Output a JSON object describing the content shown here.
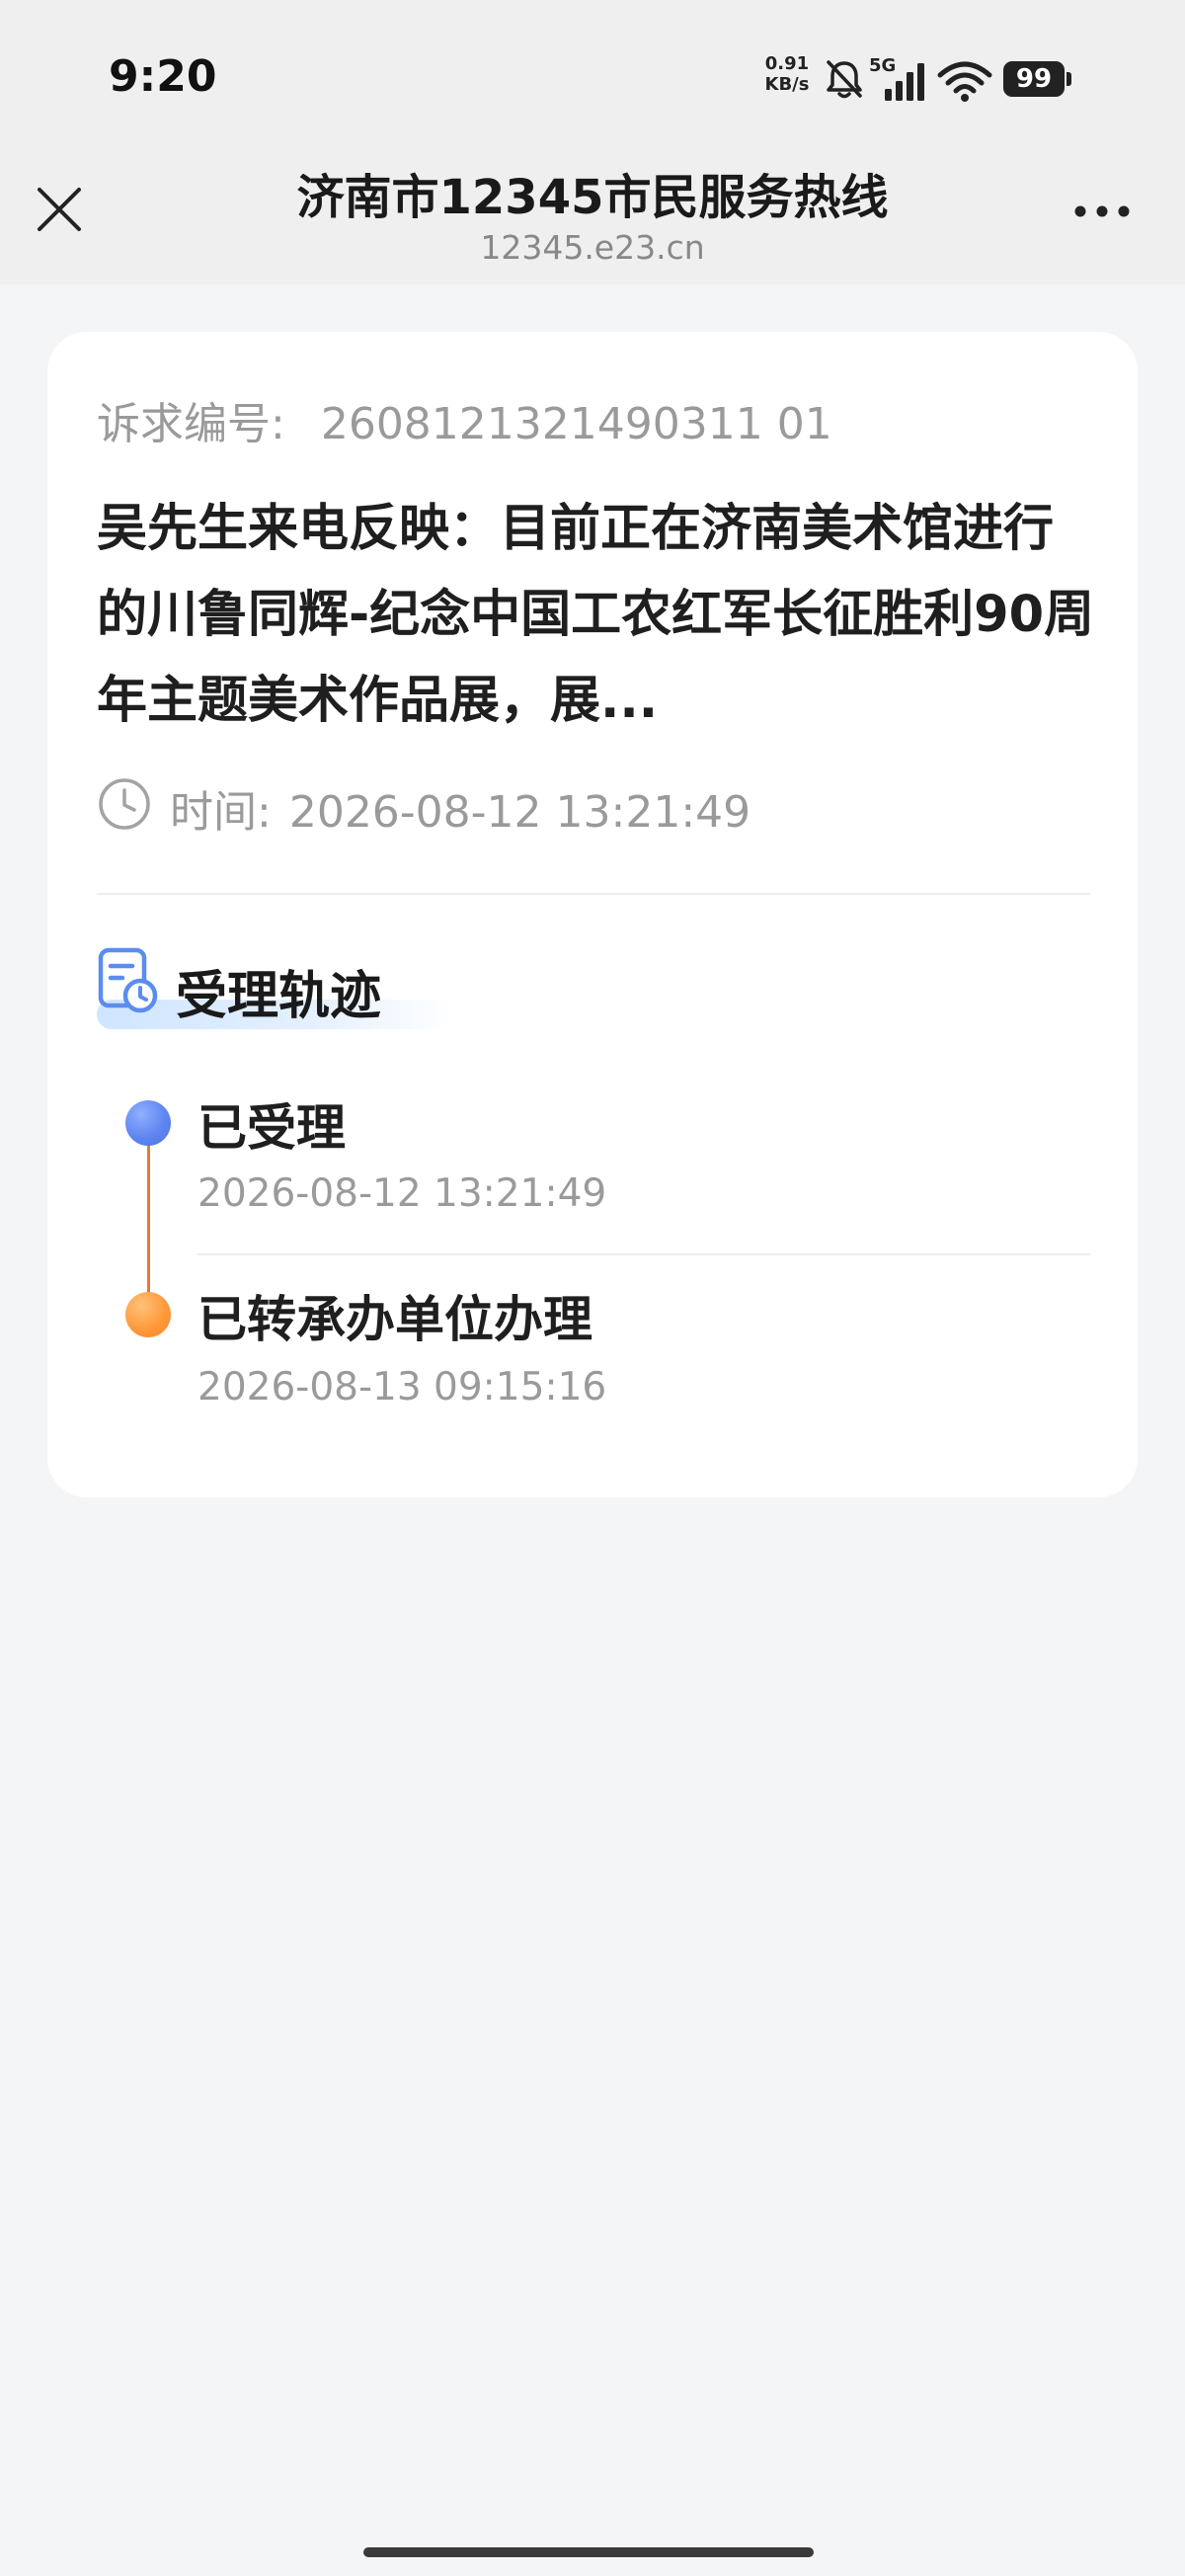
{
  "status_bar": {
    "time": "9:20",
    "net_speed_value": "0.91",
    "net_speed_unit": "KB/s",
    "network_type": "5G",
    "battery": "99",
    "icons": [
      "bell-muted-icon",
      "signal-icon",
      "wifi-icon",
      "battery-icon"
    ]
  },
  "nav": {
    "title": "济南市12345市民服务热线",
    "url": "12345.e23.cn",
    "icons": [
      "close-icon",
      "more-icon"
    ]
  },
  "case": {
    "number_label": "诉求编号:",
    "number_value": "2608121321490311 01",
    "summary": "吴先生来电反映：目前正在济南美术馆进行的川鲁同辉-纪念中国工农红军长征胜利90周年主题美术作品展，展...",
    "time_label": "时间:",
    "time_value": "2026-08-12 13:21:49"
  },
  "track": {
    "title": "受理轨迹",
    "steps": [
      {
        "label": "已受理",
        "time": "2026-08-12 13:21:49",
        "color": "#5f86f0"
      },
      {
        "label": "已转承办单位办理",
        "time": "2026-08-13 09:15:16",
        "color": "#ff9a3c"
      }
    ],
    "line_color": "#e07a3a"
  },
  "colors": {
    "background": "#f4f5f7",
    "accent_blue": "#5f86f0",
    "accent_orange": "#ff9a3c"
  }
}
